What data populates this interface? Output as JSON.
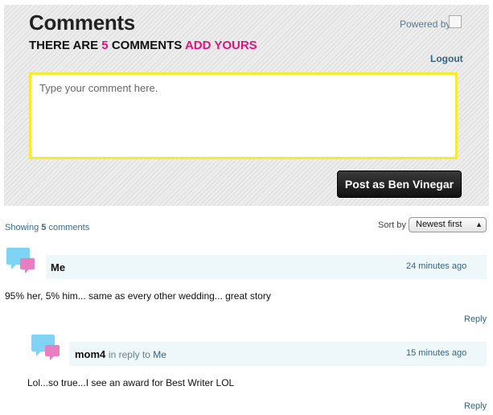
{
  "header": {
    "title": "Comments",
    "count_prefix": "THERE ARE",
    "count": "5",
    "count_suffix": "COMMENTS",
    "add_yours": "ADD YOURS",
    "powered_by": "Powered by",
    "logout": "Logout"
  },
  "composer": {
    "placeholder": "Type your comment here.",
    "post_button": "Post as Ben Vinegar"
  },
  "list": {
    "showing_prefix": "Showing",
    "showing_count": "5",
    "showing_suffix": "comments",
    "sort_label": "Sort by",
    "sort_selected": "Newest first"
  },
  "comments": [
    {
      "author": "Me",
      "time": "24 minutes ago",
      "text": "95% her, 5% him... same as every other wedding... great story",
      "reply": "Reply"
    },
    {
      "author": "mom4",
      "reply_to_prefix": "in reply to",
      "reply_to": "Me",
      "time": "15 minutes ago",
      "text": "Lol...so true...I see an award for Best Writer LOL",
      "reply": "Reply"
    }
  ],
  "colors": {
    "accent_pink": "#e0157e",
    "textbox_border": "#f6ec2b",
    "link_blue": "#36627f",
    "comment_bar": "#eef8fb"
  }
}
